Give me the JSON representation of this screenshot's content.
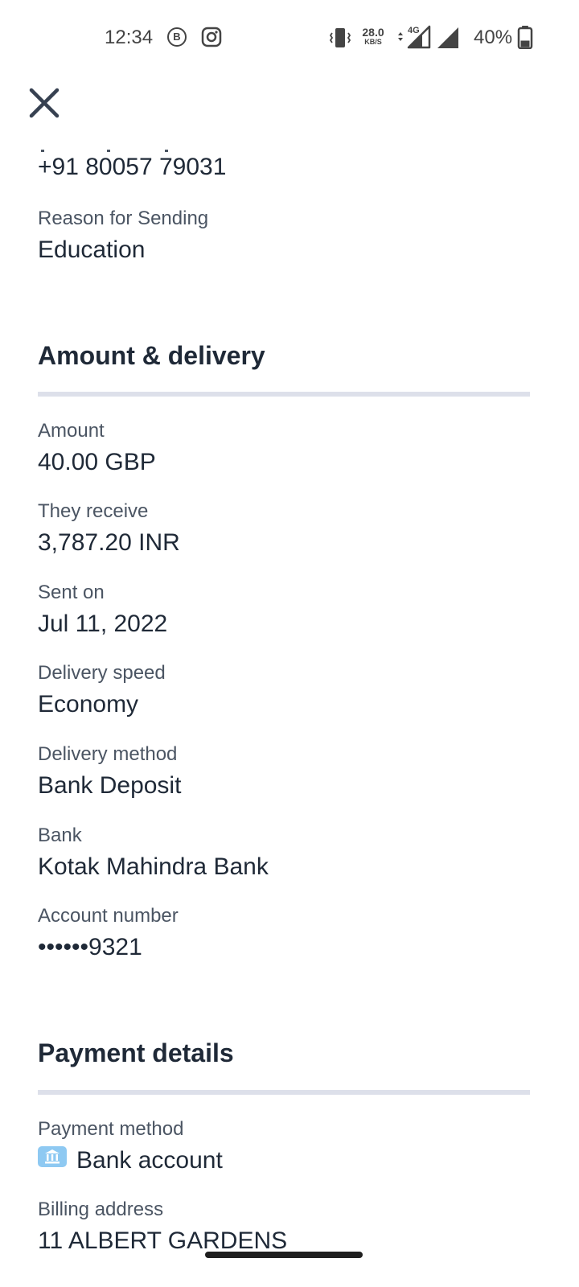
{
  "status_bar": {
    "time": "12:34",
    "b_badge": "B",
    "net_speed_value": "28.0",
    "net_speed_unit": "KB/S",
    "network_type": "4G",
    "battery_percent": "40%",
    "battery_level": 0.4,
    "icons": [
      "beeper-icon",
      "instagram-icon",
      "vibrate-icon",
      "signal-4g-icon",
      "signal-icon",
      "battery-icon"
    ]
  },
  "header": {
    "close_icon": "close-icon"
  },
  "recipient": {
    "phone": "+91 80057 79031",
    "reason_label": "Reason for Sending",
    "reason_value": "Education"
  },
  "amount_delivery": {
    "title": "Amount & delivery",
    "fields": [
      {
        "label": "Amount",
        "value": "40.00 GBP"
      },
      {
        "label": "They receive",
        "value": "3,787.20 INR"
      },
      {
        "label": "Sent on",
        "value": "Jul 11, 2022"
      },
      {
        "label": "Delivery speed",
        "value": "Economy"
      },
      {
        "label": "Delivery method",
        "value": "Bank Deposit"
      },
      {
        "label": "Bank",
        "value": "Kotak Mahindra Bank"
      },
      {
        "label": "Account number",
        "value": "••••••9321"
      }
    ]
  },
  "payment_details": {
    "title": "Payment details",
    "method_label": "Payment method",
    "method_value": "Bank account",
    "method_icon": "bank-icon",
    "billing_label": "Billing address",
    "billing_value": "11 ALBERT GARDENS"
  },
  "colors": {
    "text": "#1f2937",
    "label": "#4b5563",
    "divider": "#dde0ea",
    "bank_icon_bg": "#8ec9f2"
  }
}
